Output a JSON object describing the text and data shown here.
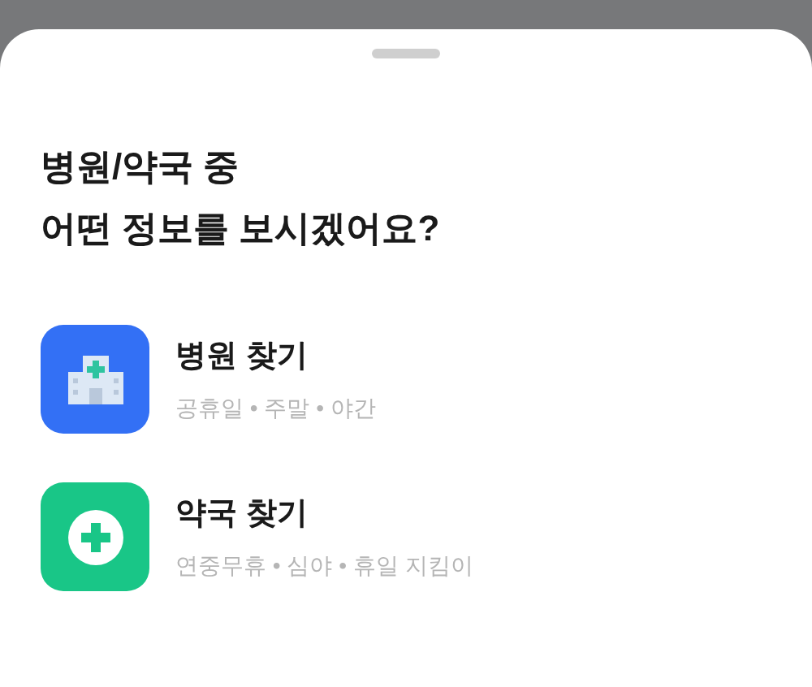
{
  "sheet": {
    "title_lines": [
      "병원/약국 중",
      "어떤 정보를 보시겠어요?"
    ],
    "options": [
      {
        "kind": "hospital",
        "title": "병원 찾기",
        "subtitle": "공휴일 • 주말 • 야간"
      },
      {
        "kind": "pharmacy",
        "title": "약국 찾기",
        "subtitle": "연중무휴 • 심야 • 휴일 지킴이"
      }
    ]
  }
}
